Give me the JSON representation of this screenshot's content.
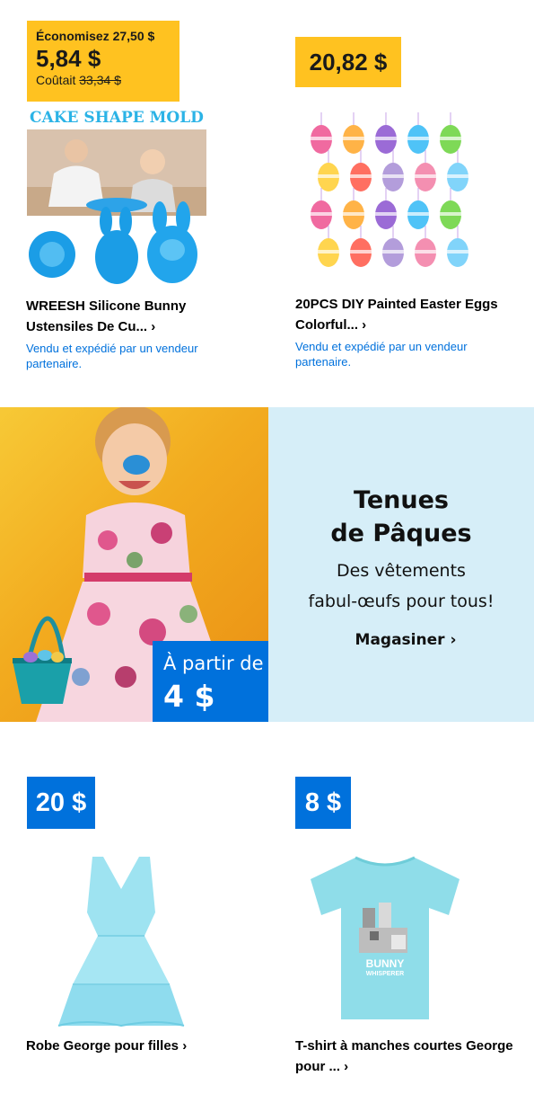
{
  "products_top": [
    {
      "save_text": "Économisez 27,50 $",
      "price": "5,84 $",
      "was_prefix": "Coûtait",
      "was_price": "33,34 $",
      "image_banner": "CAKE SHAPE MOLD",
      "title_line1": "WREESH Silicone Bunny",
      "title_line2": "Ustensiles De Cu...",
      "seller_line1": "Vendu et expédié par un vendeur",
      "seller_line2": "partenaire."
    },
    {
      "price": "20,82 $",
      "title_line1": "20PCS DIY Painted Easter Eggs",
      "title_line2": "Colorful...",
      "seller_line1": "Vendu et expédié par un vendeur",
      "seller_line2": "partenaire."
    }
  ],
  "hero": {
    "title_line1": "Tenues",
    "title_line2": "de Pâques",
    "sub_line1": "Des vêtements",
    "sub_line2": "fabul-œufs pour tous!",
    "cta": "Magasiner",
    "badge_line1": "À partir de",
    "badge_line2": "4 $"
  },
  "products_bottom": [
    {
      "price": "20 $",
      "title_line1": "Robe George pour filles",
      "title_line2": ""
    },
    {
      "price": "8 $",
      "title_line1": "T-shirt à manches courtes George",
      "title_line2": "pour ...",
      "shirt_text1": "BUNNY",
      "shirt_text2": "WHISPERER"
    }
  ],
  "icons": {
    "chevron": "›"
  },
  "colors": {
    "yellow": "#ffc220",
    "blue": "#0071dc",
    "light_blue": "#d6eef8"
  }
}
